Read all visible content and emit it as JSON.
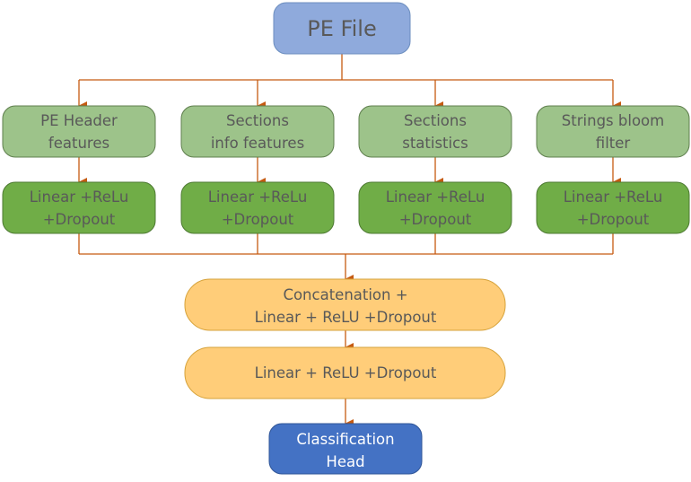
{
  "colors": {
    "input_node": "#8faadc",
    "feature_node": "#9dc38a",
    "linear_node": "#70ad47",
    "fusion_node": "#ffcd79",
    "head_node": "#4472c4",
    "connector": "#c55a11",
    "text": "#595959"
  },
  "input": {
    "label": "PE File"
  },
  "branches": [
    {
      "feature": [
        "PE Header",
        "features"
      ],
      "layer": [
        "Linear +ReLu",
        "+Dropout"
      ]
    },
    {
      "feature": [
        "Sections",
        "info features"
      ],
      "layer": [
        "Linear +ReLu",
        "+Dropout"
      ]
    },
    {
      "feature": [
        "Sections",
        "statistics"
      ],
      "layer": [
        "Linear +ReLu",
        "+Dropout"
      ]
    },
    {
      "feature": [
        "Strings bloom",
        "filter"
      ],
      "layer": [
        "Linear +ReLu",
        "+Dropout"
      ]
    }
  ],
  "fusion": {
    "lines": [
      "Concatenation +",
      "Linear + ReLU +Dropout"
    ]
  },
  "dense": {
    "label": "Linear + ReLU +Dropout"
  },
  "head": {
    "lines": [
      "Classification",
      "Head"
    ]
  }
}
